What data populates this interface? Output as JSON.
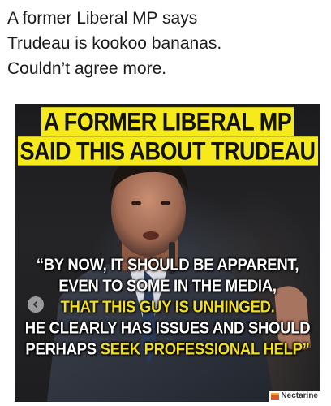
{
  "post": {
    "caption_lines": [
      "A former Liberal MP says",
      "Trudeau is kookoo bananas.",
      "Couldn’t agree more."
    ]
  },
  "meme": {
    "headline_lines": [
      "A FORMER LIBERAL MP",
      "SAID THIS ABOUT TRUDEAU"
    ],
    "quote_lines": [
      "“BY NOW, IT SHOULD BE APPARENT,",
      "EVEN TO SOME IN THE MEDIA,",
      "THAT THIS GUY IS UNHINGED.",
      "HE CLEARLY HAS ISSUES AND SHOULD"
    ],
    "quote_last_line_plain": "PERHAPS ",
    "quote_last_line_highlight": "SEEK PROFESSIONAL HELP”",
    "watermark": "Nectarine",
    "colors": {
      "headline_bg": "#f6ea1a",
      "quote_white": "#ffffff",
      "quote_yellow": "#f2de1f"
    }
  },
  "icons": {
    "nav": "chevron-left-icon",
    "watermark_logo": "nectarine-logo-icon"
  }
}
